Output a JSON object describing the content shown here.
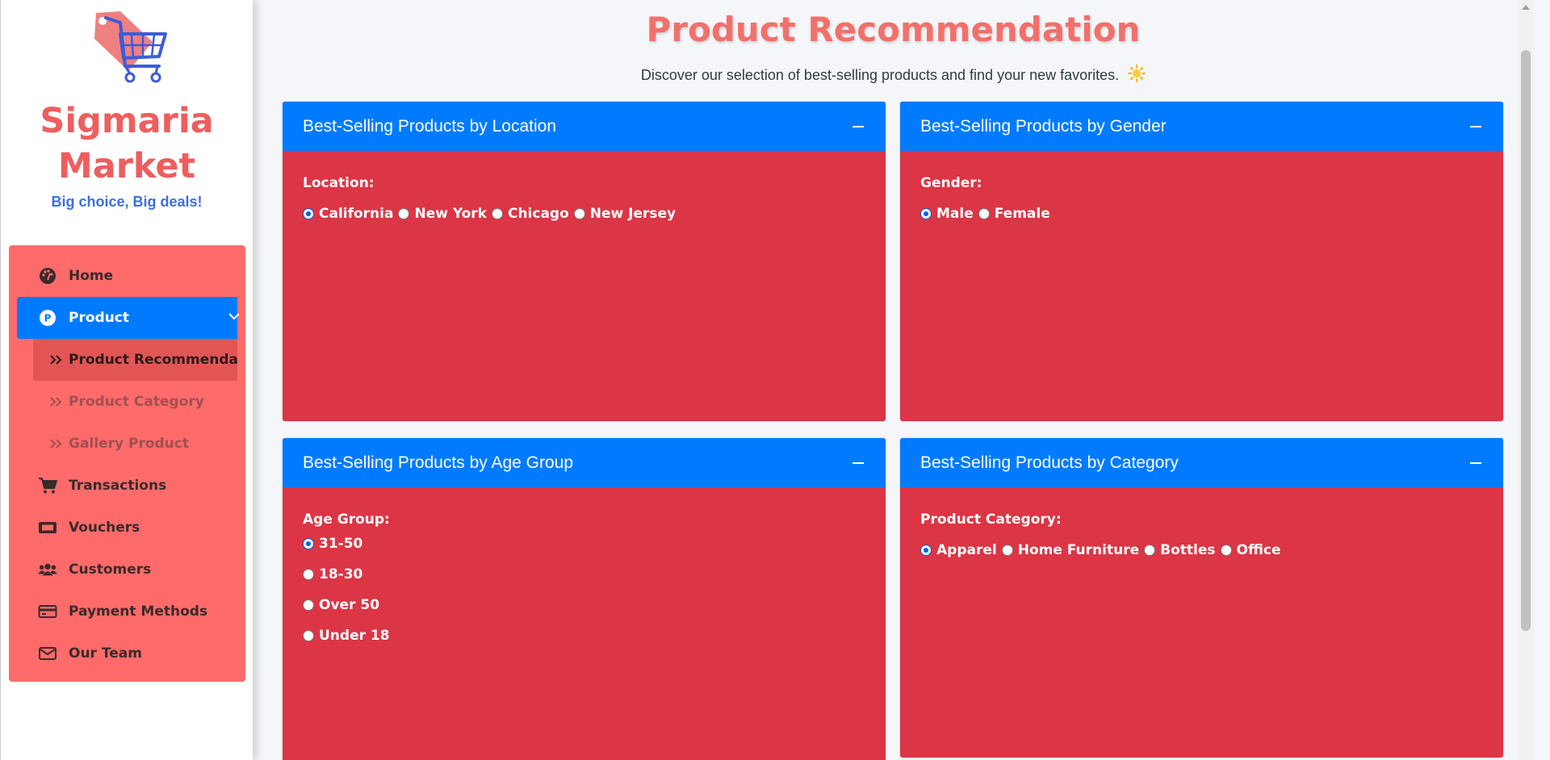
{
  "brand": {
    "name_line1": "Sigmaria",
    "name_line2": "Market",
    "tagline": "Big choice, Big deals!",
    "logo_icon": "shopping-cart-tag-logo"
  },
  "sidebar": {
    "items": [
      {
        "label": "Home",
        "icon": "dashboard-icon"
      },
      {
        "label": "Product",
        "icon": "product-p-icon",
        "active": true
      },
      {
        "label": "Transactions",
        "icon": "cart-icon"
      },
      {
        "label": "Vouchers",
        "icon": "ticket-icon"
      },
      {
        "label": "Customers",
        "icon": "users-icon"
      },
      {
        "label": "Payment Methods",
        "icon": "credit-card-icon"
      },
      {
        "label": "Our Team",
        "icon": "envelope-icon"
      }
    ],
    "sub_items": [
      {
        "label": "Product Recommendation",
        "current": true
      },
      {
        "label": "Product Category"
      },
      {
        "label": "Gallery Product"
      }
    ]
  },
  "page": {
    "title": "Product Recommendation",
    "subtitle": "Discover our selection of best-selling products and find your new favorites."
  },
  "cards": {
    "location": {
      "title": "Best-Selling Products by Location",
      "label": "Location:",
      "options": [
        "California",
        "New York",
        "Chicago",
        "New Jersey"
      ],
      "selected": "California"
    },
    "gender": {
      "title": "Best-Selling Products by Gender",
      "label": "Gender:",
      "options": [
        "Male",
        "Female"
      ],
      "selected": "Male"
    },
    "age": {
      "title": "Best-Selling Products by Age Group",
      "label": "Age Group:",
      "options": [
        "31-50",
        "18-30",
        "Over 50",
        "Under 18"
      ],
      "selected": "31-50"
    },
    "category": {
      "title": "Best-Selling Products by Category",
      "label": "Product Category:",
      "options": [
        "Apparel",
        "Home Furniture",
        "Bottles",
        "Office"
      ],
      "selected": "Apparel"
    }
  },
  "colors": {
    "brand": "#ee5e5e",
    "tagline": "#3d6fe0",
    "nav_bg": "#ff6b6b",
    "accent_blue": "#007bff",
    "card_red": "#dc3545",
    "title": "#f2706b"
  }
}
